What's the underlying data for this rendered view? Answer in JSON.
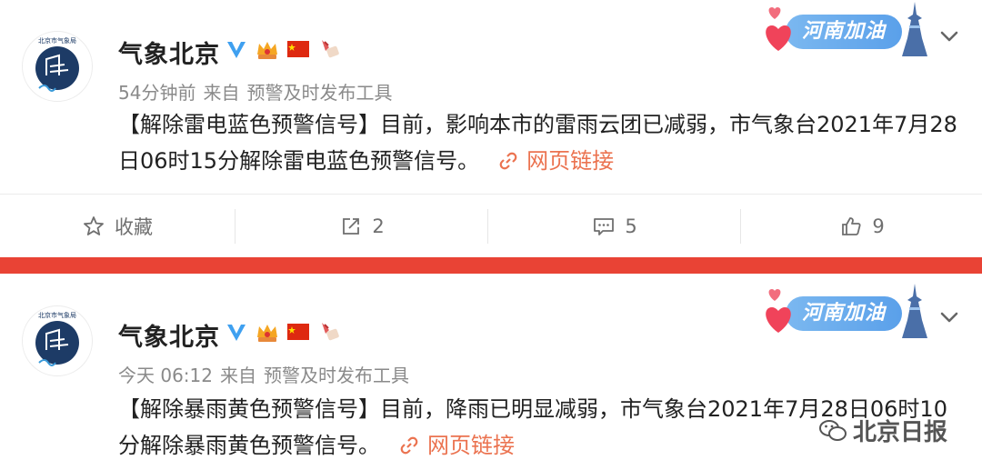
{
  "posts": [
    {
      "account_name": "气象北京",
      "avatar_label": "北京市气象局",
      "meta_time": "54分钟前",
      "meta_from": "来自",
      "meta_source": "预警及时发布工具",
      "text": "【解除雷电蓝色预警信号】目前，影响本市的雷雨云团已减弱，市气象台2021年7月28日06时15分解除雷电蓝色预警信号。",
      "link_label": "网页链接",
      "promo_label": "河南加油",
      "actions": {
        "favorite_label": "收藏",
        "repost_count": "2",
        "comment_count": "5",
        "like_count": "9"
      }
    },
    {
      "account_name": "气象北京",
      "avatar_label": "北京市气象局",
      "meta_time": "今天 06:12",
      "meta_from": "来自",
      "meta_source": "预警及时发布工具",
      "text": "【解除暴雨黄色预警信号】目前，降雨已明显减弱，市气象台2021年7月28日06时10分解除暴雨黄色预警信号。",
      "link_label": "网页链接",
      "promo_label": "河南加油"
    }
  ],
  "watermark": {
    "label": "北京日报"
  },
  "colors": {
    "link": "#eb7350",
    "divider": "#e94335",
    "meta_text": "#8a8a8a",
    "verified": "#3fa0f0"
  },
  "icons": {
    "verified": "verified-v-icon",
    "crown": "crown-badge-icon",
    "flag": "china-flag-icon",
    "fan": "fan-badge-icon",
    "link": "link-chain-icon",
    "more": "chevron-down-icon",
    "favorite": "star-icon",
    "repost": "share-icon",
    "comment": "comment-icon",
    "like": "thumbs-up-icon"
  }
}
